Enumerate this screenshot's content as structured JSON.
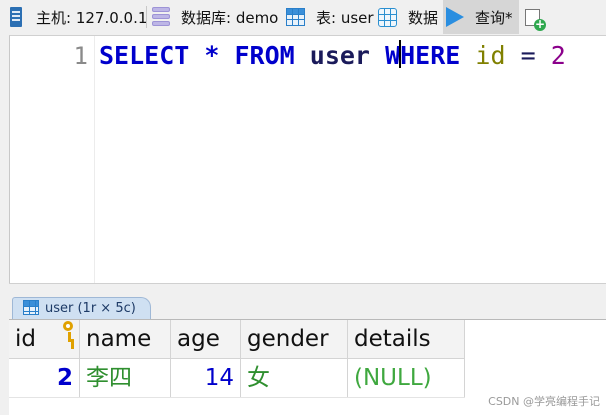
{
  "tabs": {
    "host": "主机: 127.0.0.1",
    "database": "数据库: demo",
    "table": "表: user",
    "data": "数据",
    "query": "查询*"
  },
  "editor": {
    "line_number": "1",
    "sql": {
      "select": "SELECT",
      "star": "*",
      "from": "FROM",
      "table": "user",
      "where_before_caret": "W",
      "where_after_caret": "HERE",
      "column": "id",
      "equals": "=",
      "value": "2"
    }
  },
  "result_tab": {
    "label": "user (1r × 5c)"
  },
  "grid": {
    "columns": [
      "id",
      "name",
      "age",
      "gender",
      "details"
    ],
    "rows": [
      [
        "2",
        "李四",
        "14",
        "女",
        "(NULL)"
      ]
    ]
  },
  "watermark": "CSDN @学亮编程手记"
}
